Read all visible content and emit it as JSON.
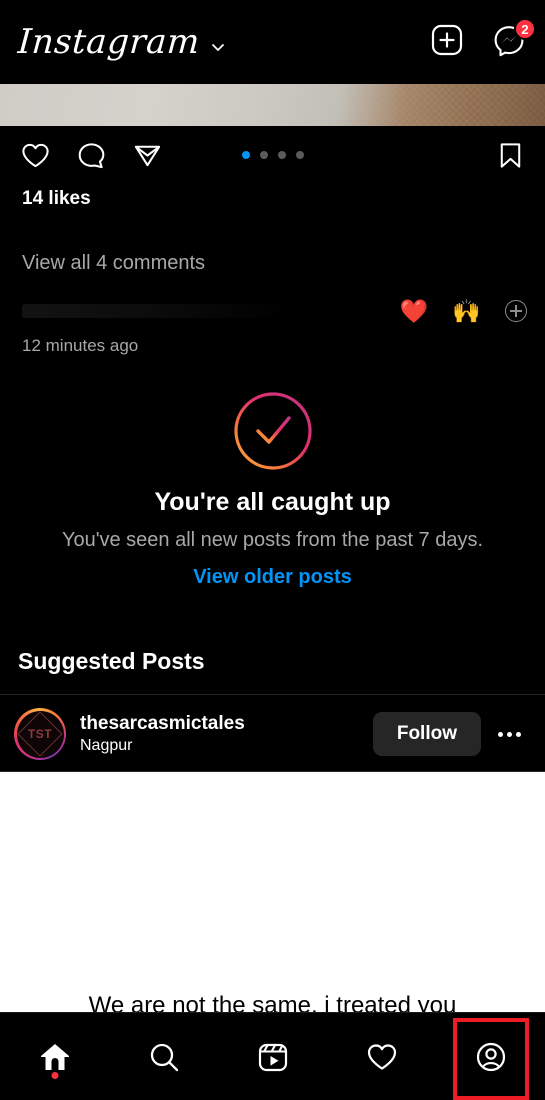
{
  "header": {
    "logo_text": "Instagram",
    "chevron_icon": "chevron-down-icon",
    "create_icon": "plus-square-icon",
    "messenger_icon": "messenger-icon",
    "messenger_badge": "2"
  },
  "post": {
    "like_icon": "heart-icon",
    "comment_icon": "comment-bubble-icon",
    "share_icon": "paper-plane-icon",
    "save_icon": "bookmark-icon",
    "carousel": {
      "count": 4,
      "active_index": 0,
      "active_color": "#0095F6",
      "inactive_color": "#5a5a5a"
    },
    "likes_text": "14 likes",
    "view_comments_text": "View all 4 comments",
    "quick_reactions": [
      "❤️",
      "🙌"
    ],
    "add_reaction_icon": "plus-circle-icon",
    "timestamp": "12 minutes ago"
  },
  "caught_up": {
    "check_icon": "check-circle-gradient-icon",
    "title": "You're all caught up",
    "subtitle": "You've seen all new posts from the past 7 days.",
    "link_label": "View older posts",
    "link_color": "#0095F6"
  },
  "suggested": {
    "section_title": "Suggested Posts",
    "account": {
      "avatar_initials": "TST",
      "avatar_name": "avatar",
      "username": "thesarcasmictales",
      "location": "Nagpur"
    },
    "follow_label": "Follow",
    "more_icon": "more-options-icon",
    "post_caption": "We are not the same, i treated you"
  },
  "bottom_nav": {
    "items": [
      {
        "name": "home",
        "icon": "home-icon",
        "active": true,
        "has_dot": true
      },
      {
        "name": "search",
        "icon": "search-icon",
        "active": false,
        "has_dot": false
      },
      {
        "name": "reels",
        "icon": "reels-icon",
        "active": false,
        "has_dot": false
      },
      {
        "name": "activity",
        "icon": "heart-icon",
        "active": false,
        "has_dot": false
      },
      {
        "name": "profile",
        "icon": "profile-circle-icon",
        "active": false,
        "has_dot": false,
        "highlighted": true
      }
    ],
    "highlight_color": "#EE1C25"
  }
}
